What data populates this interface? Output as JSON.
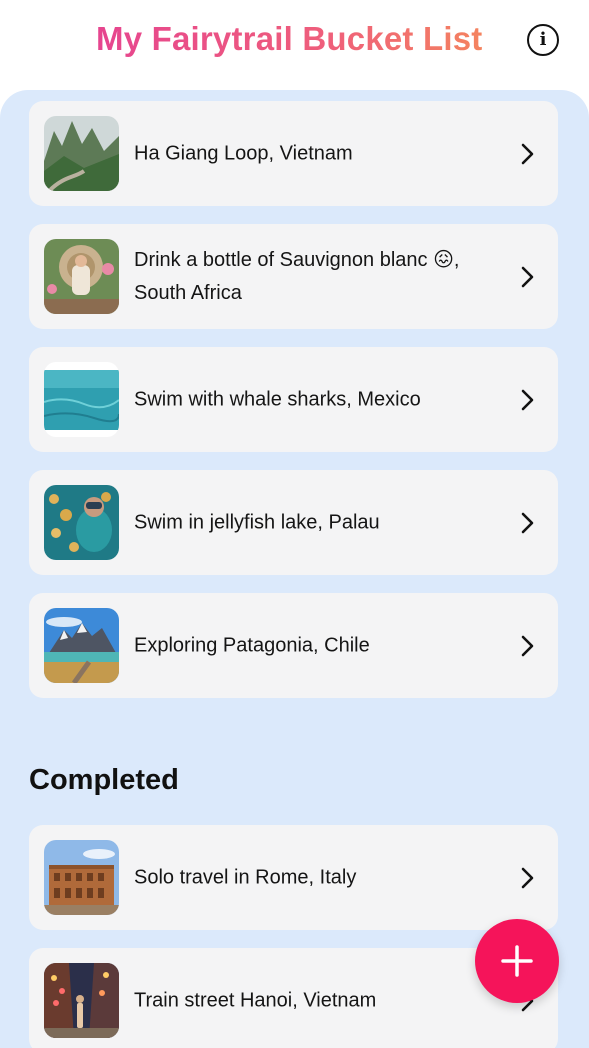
{
  "header": {
    "title": "My Fairytrail Bucket List",
    "info_icon": "info-circle-icon",
    "title_gradient": [
      "#e6458f",
      "#f4835f"
    ]
  },
  "bucket_list": {
    "items": [
      {
        "label": "Ha Giang Loop, Vietnam",
        "image": "green mountains road photo"
      },
      {
        "label": "Drink a bottle of Sauvignon blanc 😖, South Africa",
        "image": "woman in wicker chair photo"
      },
      {
        "label": "Swim with whale sharks, Mexico",
        "image": "turquoise sea photo"
      },
      {
        "label": "Swim in jellyfish lake, Palau",
        "image": "snorkeler with jellyfish photo"
      },
      {
        "label": "Exploring Patagonia, Chile",
        "image": "patagonia mountains photo"
      }
    ]
  },
  "completed": {
    "title": "Completed",
    "items": [
      {
        "label": "Solo travel in Rome, Italy",
        "image": "colosseum photo"
      },
      {
        "label": "Train street Hanoi, Vietnam",
        "image": "train street night photo"
      }
    ]
  },
  "fab": {
    "icon": "plus-icon",
    "color": "#f5145a"
  },
  "colors": {
    "panel_background": "#dbe9fb",
    "card_background": "#f4f4f5"
  }
}
